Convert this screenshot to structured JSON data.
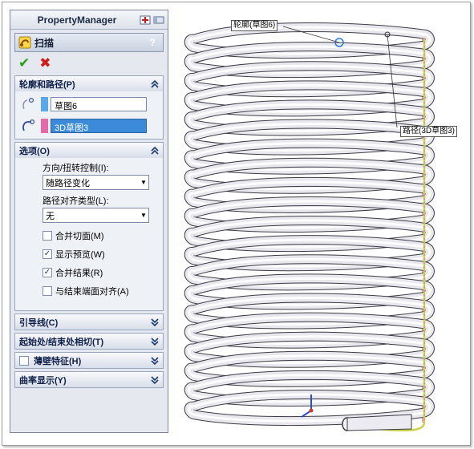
{
  "panel": {
    "title": "PropertyManager",
    "feature_name": "扫描",
    "help_label": "?",
    "ok_label": "✔",
    "cancel_label": "✖"
  },
  "profile_path": {
    "header": "轮廓和路径(P)",
    "profile_value": "草图6",
    "profile_color": "#5aa8e8",
    "path_value": "3D草图3",
    "path_color": "#e46aa8"
  },
  "options": {
    "header": "选项(O)",
    "orientation_label": "方向/扭转控制(I):",
    "orientation_value": "随路径变化",
    "align_label": "路径对齐类型(L):",
    "align_value": "无",
    "checkboxes": [
      {
        "label": "合并切面(M)",
        "checked": false
      },
      {
        "label": "显示预览(W)",
        "checked": true
      },
      {
        "label": "合并结果(R)",
        "checked": true
      },
      {
        "label": "与结束端面对齐(A)",
        "checked": false
      }
    ]
  },
  "collapsed_sections": [
    {
      "label": "引导线(C)"
    },
    {
      "label": "起始处/结束处相切(T)"
    },
    {
      "label": "薄壁特征(H)",
      "has_checkbox": true
    },
    {
      "label": "曲率显示(Y)"
    }
  ],
  "viewport": {
    "profile_callout": "轮廓(草图6)",
    "path_callout": "路径(3D草图3)",
    "coil_count": 20
  }
}
